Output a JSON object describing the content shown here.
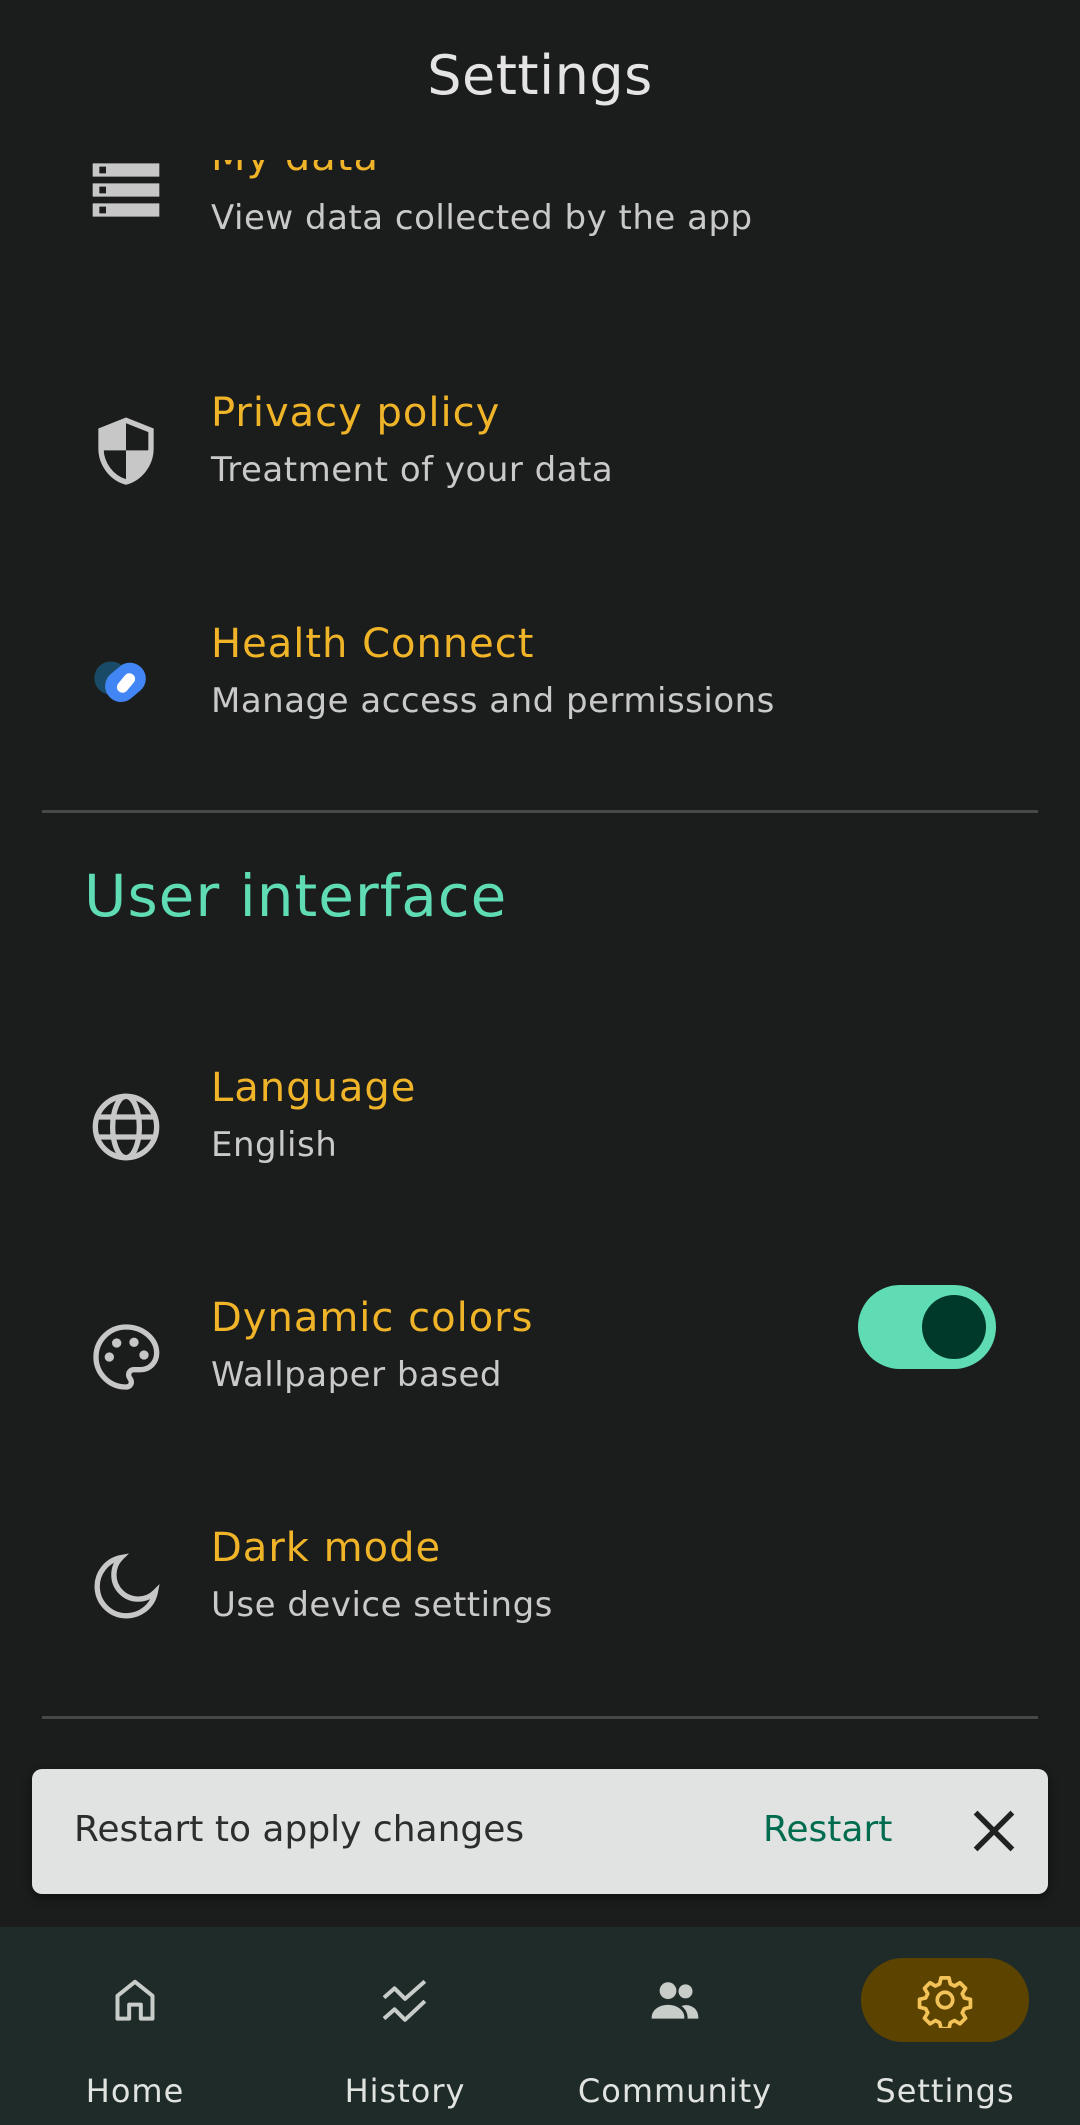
{
  "header": {
    "title": "Settings"
  },
  "privacy_items": [
    {
      "title": "My data",
      "subtitle": "View data collected by the app",
      "icon": "storage-icon"
    },
    {
      "title": "Privacy policy",
      "subtitle": "Treatment of your data",
      "icon": "shield-icon"
    },
    {
      "title": "Health Connect",
      "subtitle": "Manage access and permissions",
      "icon": "health-connect-icon"
    }
  ],
  "ui_section": {
    "title": "User interface",
    "items": [
      {
        "title": "Language",
        "subtitle": "English",
        "icon": "globe-icon"
      },
      {
        "title": "Dynamic colors",
        "subtitle": "Wallpaper based",
        "icon": "palette-icon",
        "toggle_on": true
      },
      {
        "title": "Dark mode",
        "subtitle": "Use device settings",
        "icon": "moon-icon"
      }
    ]
  },
  "snackbar": {
    "message": "Restart to apply changes",
    "action": "Restart",
    "close_icon": "close-icon"
  },
  "nav": {
    "items": [
      {
        "label": "Home",
        "icon": "home-icon"
      },
      {
        "label": "History",
        "icon": "history-icon"
      },
      {
        "label": "Community",
        "icon": "community-icon"
      },
      {
        "label": "Settings",
        "icon": "gear-icon",
        "active": true
      }
    ]
  },
  "colors": {
    "background": "#1b1c1c",
    "item_title": "#f0b429",
    "section_header": "#5fdcb4",
    "toggle_track": "#5fdcb4",
    "nav_background": "#1f2b29",
    "nav_active": "#5c4400"
  }
}
